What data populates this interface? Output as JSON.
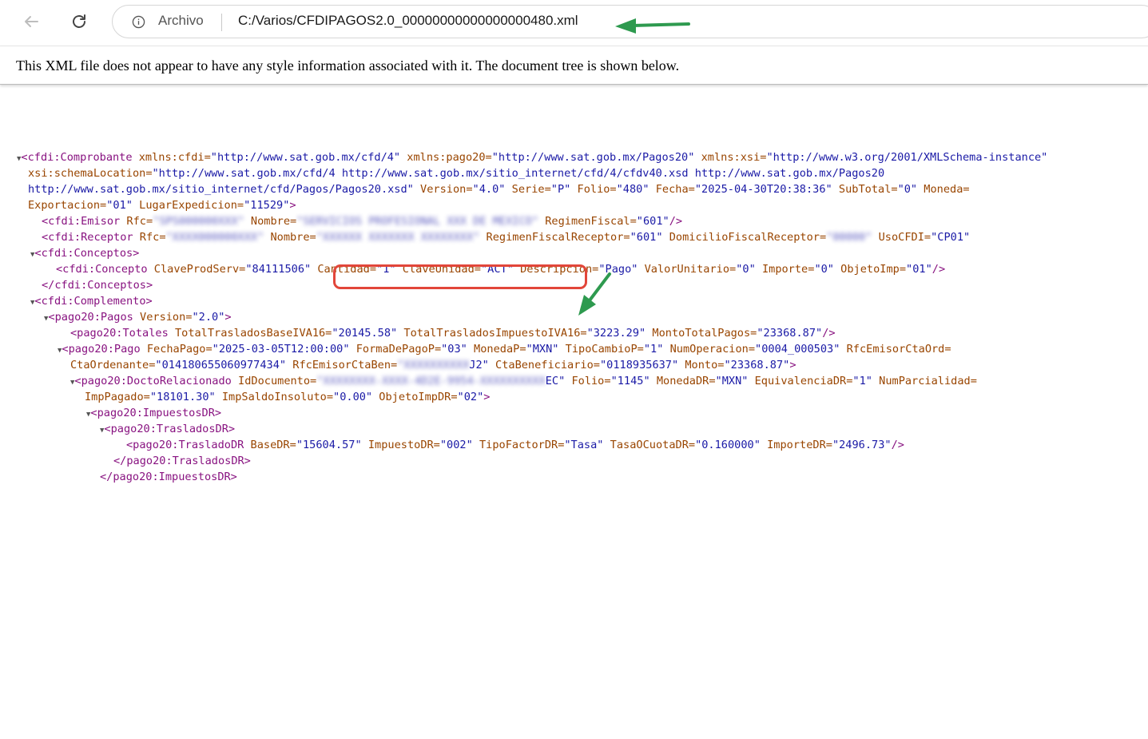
{
  "browser": {
    "scheme_label": "Archivo",
    "url": "C:/Varios/CFDIPAGOS2.0_00000000000000000480.xml",
    "icons": [
      "back-arrow-icon",
      "reload-icon",
      "info-icon"
    ]
  },
  "notice": {
    "text": "This XML file does not appear to have any style information associated with it. The document tree is shown below."
  },
  "xml_lines": {
    "l01": {
      "t1": "<cfdi:Comprobante",
      "a1": " xmlns:cfdi=",
      "v1": "\"http://www.sat.gob.mx/cfd/4\"",
      "a2": " xmlns:pago20=",
      "v2": "\"http://www.sat.gob.mx/Pagos20\"",
      "a3": " xmlns:xsi=",
      "v3": "\"http://www.w3.org/2001/XMLSchema-instance\""
    },
    "l02": {
      "a1": "xsi:schemaLocation=",
      "v1": "\"http://www.sat.gob.mx/cfd/4 http://www.sat.gob.mx/sitio_internet/cfd/4/cfdv40.xsd http://www.sat.gob.mx/Pagos20"
    },
    "l03": {
      "v1": "http://www.sat.gob.mx/sitio_internet/cfd/Pagos/Pagos20.xsd\"",
      "a1": " Version=",
      "v2": "\"4.0\"",
      "a2": " Serie=",
      "v3": "\"P\"",
      "a3": " Folio=",
      "v4": "\"480\"",
      "a4": " Fecha=",
      "v5": "\"2025-04-30T20:38:36\"",
      "a5": " SubTotal=",
      "v6": "\"0\"",
      "a6": " Moneda="
    },
    "l04": {
      "a1": "Exportacion=",
      "v1": "\"01\"",
      "a2": " LugarExpedicion=",
      "v2": "\"11529\"",
      "t1": ">"
    },
    "l05": {
      "t1": "<cfdi:Emisor",
      "a1": " Rfc=",
      "b1": "\"SPS000000XXX\"",
      "a2": " Nombre=",
      "b2": "\"SERVICIOS PROFESIONAL XXX DE MEXICO\"",
      "a3": " RegimenFiscal=",
      "v1": "\"601\"",
      "t2": "/>"
    },
    "l06": {
      "t1": "<cfdi:Receptor",
      "a1": " Rfc=",
      "b1": "\"XXXX000000XXX\"",
      "a2": " Nombre=",
      "b2": "\"XXXXXX XXXXXXX XXXXXXXX\"",
      "a3": " RegimenFiscalReceptor=",
      "v1": "\"601\"",
      "a4": " DomicilioFiscalReceptor=",
      "b3": "\"00000\"",
      "a5": " UsoCFDI=",
      "v2": "\"CP01\""
    },
    "l07": {
      "t1": "<cfdi:Conceptos>"
    },
    "l08": {
      "t1": "<cfdi:Concepto",
      "a1": " ClaveProdServ=",
      "v1": "\"84111506\"",
      "a2": " Cantidad=",
      "v2": "\"1\"",
      "a3": " ClaveUnidad=",
      "v3": "\"ACT\"",
      "a4": " Descripcion=",
      "v4": "\"Pago\"",
      "a5": " ValorUnitario=",
      "v5": "\"0\"",
      "a6": " Importe=",
      "v6": "\"0\"",
      "a7": " ObjetoImp=",
      "v7": "\"01\"",
      "t2": "/>"
    },
    "l09": {
      "t1": "</cfdi:Conceptos>"
    },
    "l10": {
      "t1": "<cfdi:Complemento>"
    },
    "l11": {
      "t1": "<pago20:Pagos",
      "a1": " Version=",
      "v1": "\"2.0\"",
      "t2": ">"
    },
    "l12": {
      "t1": "<pago20:Totales",
      "a1": " TotalTrasladosBaseIVA16=",
      "v1": "\"20145.58\"",
      "a2": " TotalTrasladosImpuestoIVA16=",
      "v2": "\"3223.29\"",
      "a3": " MontoTotalPagos=",
      "v3": "\"23368.87\"",
      "t2": "/>"
    },
    "l13": {
      "t1": "<pago20:Pago",
      "a1": " FechaPago=",
      "v1": "\"2025-03-05T12:00:00\"",
      "a2": " FormaDePagoP=",
      "v2": "\"03\"",
      "a3": " MonedaP=",
      "v3": "\"MXN\"",
      "a4": " TipoCambioP=",
      "v4": "\"1\"",
      "a5": " NumOperacion=",
      "v5": "\"0004_000503\"",
      "a6": " RfcEmisorCtaOrd="
    },
    "l14": {
      "a1": "CtaOrdenante=",
      "v1": "\"014180655060977434\"",
      "a2": " RfcEmisorCtaBen=",
      "b1": "\"XXXXXXXXXX",
      "v2": "J2\"",
      "a3": " CtaBeneficiario=",
      "v3": "\"0118935637\"",
      "a4": " Monto=",
      "v4": "\"23368.87\"",
      "t1": ">"
    },
    "l15": {
      "t1": "<pago20:DoctoRelacionado",
      "a1": " IdDocumento=",
      "b1": "\"XXXXXXXX-XXXX-4D2E-9954-XXXXXXXXXX",
      "v1": "EC\"",
      "a2": " Folio=",
      "v2": "\"1145\"",
      "a3": " MonedaDR=",
      "v3": "\"MXN\"",
      "a4": " EquivalenciaDR=",
      "v4": "\"1\"",
      "a5": " NumParcialidad="
    },
    "l16": {
      "a1": "ImpPagado=",
      "v1": "\"18101.30\"",
      "a2": " ImpSaldoInsoluto=",
      "v2": "\"0.00\"",
      "a3": " ObjetoImpDR=",
      "v3": "\"02\"",
      "t1": ">"
    },
    "l17": {
      "t1": "<pago20:ImpuestosDR>"
    },
    "l18": {
      "t1": "<pago20:TrasladosDR>"
    },
    "l19": {
      "t1": "<pago20:TrasladoDR",
      "a1": " BaseDR=",
      "v1": "\"15604.57\"",
      "a2": " ImpuestoDR=",
      "v2": "\"002\"",
      "a3": " TipoFactorDR=",
      "v3": "\"Tasa\"",
      "a4": " TasaOCuotaDR=",
      "v4": "\"0.160000\"",
      "a5": " ImporteDR=",
      "v5": "\"2496.73\"",
      "t2": "/>"
    },
    "l20": {
      "t1": "</pago20:TrasladosDR>"
    },
    "l21": {
      "t1": "</pago20:ImpuestosDR>"
    }
  },
  "expander": "▼",
  "colors": {
    "tag": "#881280",
    "attr_name": "#994500",
    "attr_value": "#1a1aa6",
    "highlight": "#e2463a",
    "arrow": "#2e9a4f"
  }
}
